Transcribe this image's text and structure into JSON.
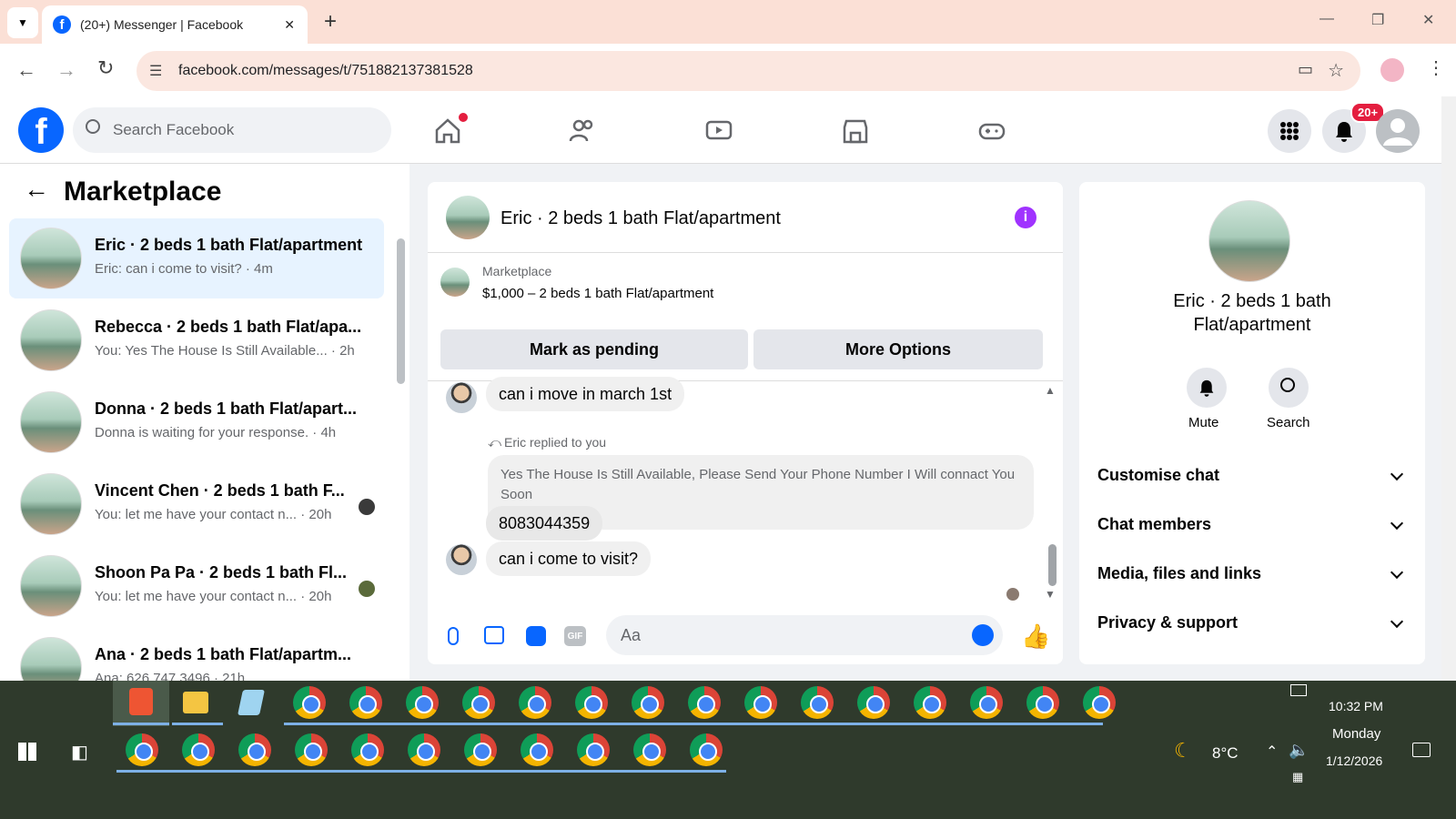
{
  "browser": {
    "tab_title": "(20+) Messenger | Facebook",
    "url": "facebook.com/messages/t/751882137381528",
    "new_tab": "+",
    "window_minimize": "—",
    "window_restore": "❐",
    "window_close": "✕"
  },
  "fb": {
    "search_placeholder": "Search Facebook",
    "notification_count": "20+"
  },
  "left": {
    "title": "Marketplace",
    "conversations": [
      {
        "name": "Eric · 2 beds 1 bath Flat/apartment",
        "preview": "Eric: can i come to visit? · 4m"
      },
      {
        "name": "Rebecca · 2 beds 1 bath Flat/apa...",
        "preview": "You: Yes The House Is Still Available... · 2h"
      },
      {
        "name": "Donna · 2 beds 1 bath Flat/apart...",
        "preview": "Donna is waiting for your response. · 4h"
      },
      {
        "name": "Vincent Chen · 2 beds 1 bath F...",
        "preview": "You: let me have your contact n... · 20h"
      },
      {
        "name": "Shoon Pa Pa · 2 beds 1 bath Fl...",
        "preview": "You: let me have your contact n... · 20h"
      },
      {
        "name": "Ana · 2 beds 1 bath Flat/apartm...",
        "preview": "Ana: 626 747 3496 · 21h"
      }
    ]
  },
  "chat": {
    "title": "Eric · 2 beds 1 bath Flat/apartment",
    "listing_source": "Marketplace",
    "listing_title": "$1,000 – 2 beds 1 bath Flat/apartment",
    "mark_pending": "Mark as pending",
    "more_options": "More Options",
    "msg1": "can i move in march 1st",
    "replied_label": "Eric replied to you",
    "quoted": "Yes The House Is Still Available, Please Send Your Phone Number I Will connact You Soon",
    "msg2": "8083044359",
    "msg3": "can i come to visit?",
    "composer_placeholder": "Aa"
  },
  "info": {
    "name": "Eric · 2 beds 1 bath Flat/apartment",
    "mute": "Mute",
    "search": "Search",
    "sections": [
      "Customise chat",
      "Chat members",
      "Media, files and links",
      "Privacy & support"
    ]
  },
  "taskbar": {
    "weather": "8°C",
    "time": "10:32 PM",
    "day": "Monday",
    "date": "1/12/2026"
  },
  "colors": {
    "fb_blue": "#0866ff",
    "badge_red": "#e41e3f",
    "info_purple": "#a033ff"
  }
}
